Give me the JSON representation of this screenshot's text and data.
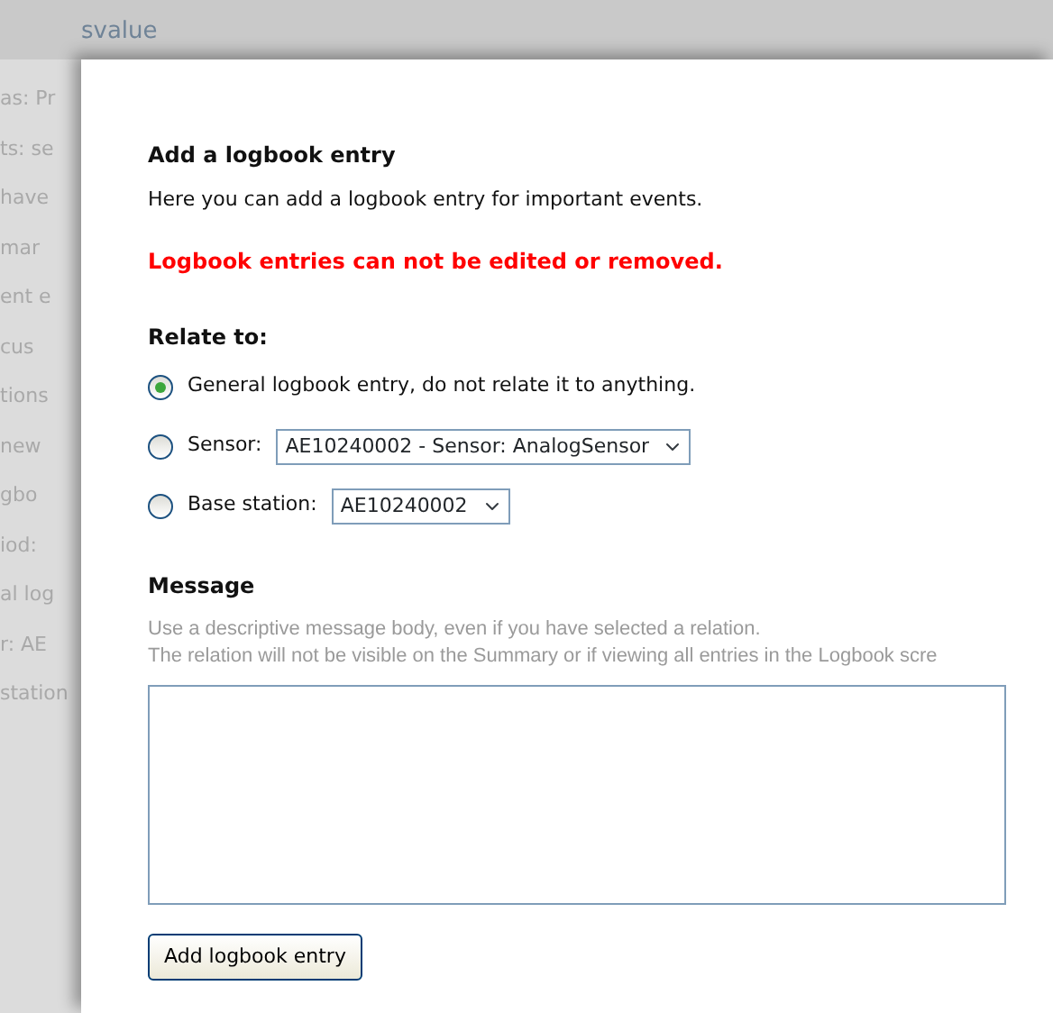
{
  "background_page": {
    "header_text": "svalue",
    "texts": [
      "as: Pr",
      "ts: se",
      "have",
      "mar",
      "ent e",
      "cus",
      "tions",
      "new",
      "gbo",
      "iod:",
      "al log",
      "r: AE",
      "station"
    ]
  },
  "dialog": {
    "title": "Add a logbook entry",
    "description": "Here you can add a logbook entry for important events.",
    "warning": "Logbook entries can not be edited or removed.",
    "relate_heading": "Relate to:",
    "options": [
      {
        "kind": "text",
        "label": "General logbook entry, do not relate it to anything.",
        "selected": true
      },
      {
        "kind": "select",
        "label": "Sensor:",
        "value": "AE10240002 - Sensor: AnalogSensor",
        "selected": false
      },
      {
        "kind": "select",
        "label": "Base station:",
        "value": "AE10240002",
        "selected": false
      }
    ],
    "message_heading": "Message",
    "hint_lines": [
      "Use a descriptive message body, even if you have selected a relation.",
      "The relation will not be visible on the Summary or if viewing all entries in the Logbook scre"
    ],
    "submit_button": "Add logbook entry"
  }
}
